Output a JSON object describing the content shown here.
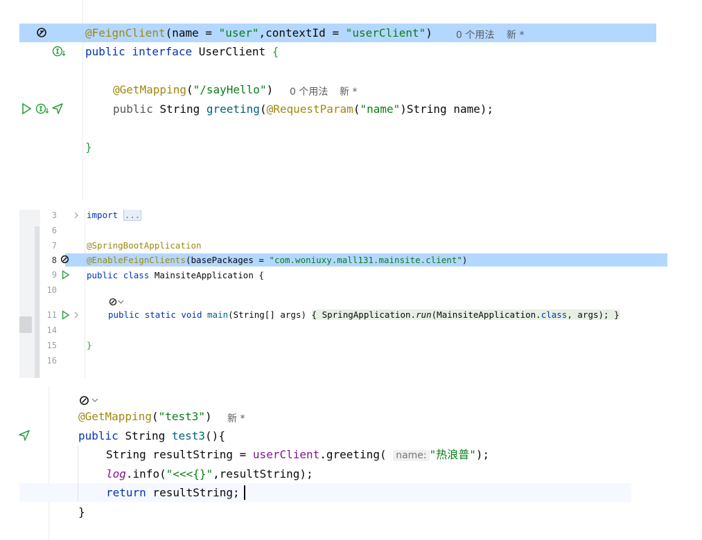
{
  "panel1": {
    "line1": {
      "annotation": "@FeignClient",
      "open": "(",
      "p1_name": "name = ",
      "p1_val": "\"user\"",
      "comma": ",",
      "p2_name": "contextId = ",
      "p2_val": "\"userClient\"",
      "close": ")",
      "usages": "0 个用法",
      "status": "新 *"
    },
    "line2": {
      "kw1": "public",
      "kw2": "interface",
      "name": "UserClient",
      "brace": "{"
    },
    "line3": {
      "annotation": "@GetMapping",
      "open": "(",
      "value": "\"/sayHello\"",
      "close": ")",
      "usages": "0 个用法",
      "status": "新 *"
    },
    "line4": {
      "kw": "public",
      "type": "String",
      "method": "greeting",
      "open": "(",
      "annotation": "@RequestParam",
      "ann_open": "(",
      "ann_val": "\"name\"",
      "ann_close": ")",
      "param": "String name",
      "close": ");"
    },
    "line5": {
      "brace": "}"
    }
  },
  "panel2": {
    "line_numbers": [
      "3",
      "6",
      "7",
      "8",
      "9",
      "10",
      "11",
      "14",
      "15",
      "16"
    ],
    "import": {
      "kw": "import",
      "folded": "..."
    },
    "ann1": "@SpringBootApplication",
    "ann2": {
      "annotation": "@EnableFeignClients",
      "open": "(",
      "param": "basePackages = ",
      "value": "\"com.woniuxy.mall131.mainsite.client\"",
      "close": ")"
    },
    "class_decl": {
      "kw1": "public",
      "kw2": "class",
      "name": "MainsiteApplication",
      "brace": "{"
    },
    "main_decl": {
      "kw1": "public",
      "kw2": "static",
      "kw3": "void",
      "method": "main",
      "params": "(String[] args)",
      "open_brace": "{",
      "body_obj": "SpringApplication.",
      "body_call": "run",
      "body_args1": "(MainsiteApplication.",
      "body_kw": "class",
      "body_args2": ", args);",
      "close_brace": "}"
    },
    "close1": "}"
  },
  "panel3": {
    "ann": {
      "annotation": "@GetMapping",
      "open": "(",
      "value": "\"test3\"",
      "close": ")",
      "status": "新 *"
    },
    "decl": {
      "kw": "public",
      "type": "String",
      "method": "test3",
      "rest": "(){"
    },
    "stmt1": {
      "lhs": "String resultString = ",
      "obj": "userClient",
      "call": ".greeting(",
      "hint_label": "name:",
      "value": "\"热浪普\"",
      "close": ");"
    },
    "stmt2": {
      "obj": "log",
      "call": ".info(",
      "value": "\"<<<{}\"",
      "rest": ",resultString",
      "close": ");"
    },
    "stmt3": {
      "kw": "return",
      "rest": " resultString;"
    },
    "close": "}"
  }
}
